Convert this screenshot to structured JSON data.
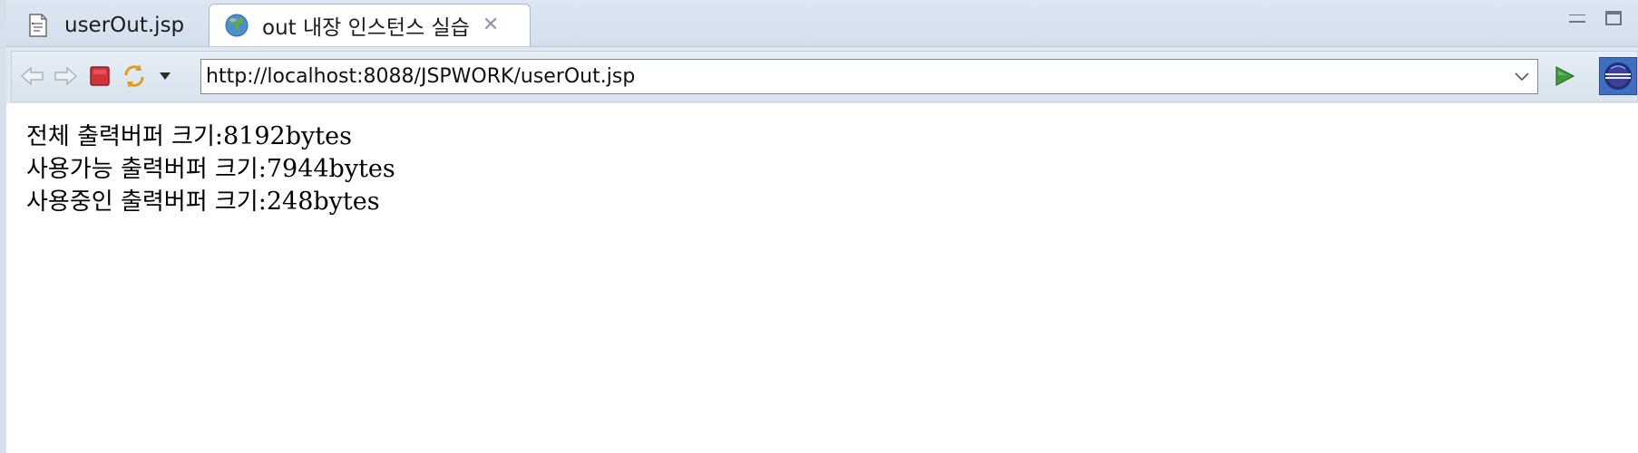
{
  "tabs": [
    {
      "label": "userOut.jsp",
      "active": false,
      "icon": "jsp-file-icon"
    },
    {
      "label": "out 내장 인스턴스 실습",
      "active": true,
      "icon": "globe-icon"
    }
  ],
  "toolbar": {
    "back_icon": "back-arrow-icon",
    "forward_icon": "forward-arrow-icon",
    "stop_icon": "stop-icon",
    "refresh_icon": "refresh-icon",
    "menu_icon": "dropdown-menu-icon",
    "go_icon": "go-icon",
    "url": "http://localhost:8088/JSPWORK/userOut.jsp"
  },
  "content": {
    "lines": [
      {
        "label": "전체 출력버퍼 크기",
        "value": ":8192bytes"
      },
      {
        "label": "사용가능 출력버퍼 크기",
        "value": ":7944bytes"
      },
      {
        "label": "사용중인 출력버퍼 크기",
        "value": ":248bytes"
      }
    ]
  },
  "colors": {
    "chrome": "#d6e0ea",
    "stop_red": "#d0343a",
    "go_green": "#3e9b3b",
    "eclipse_blue": "#3d6fc0"
  }
}
